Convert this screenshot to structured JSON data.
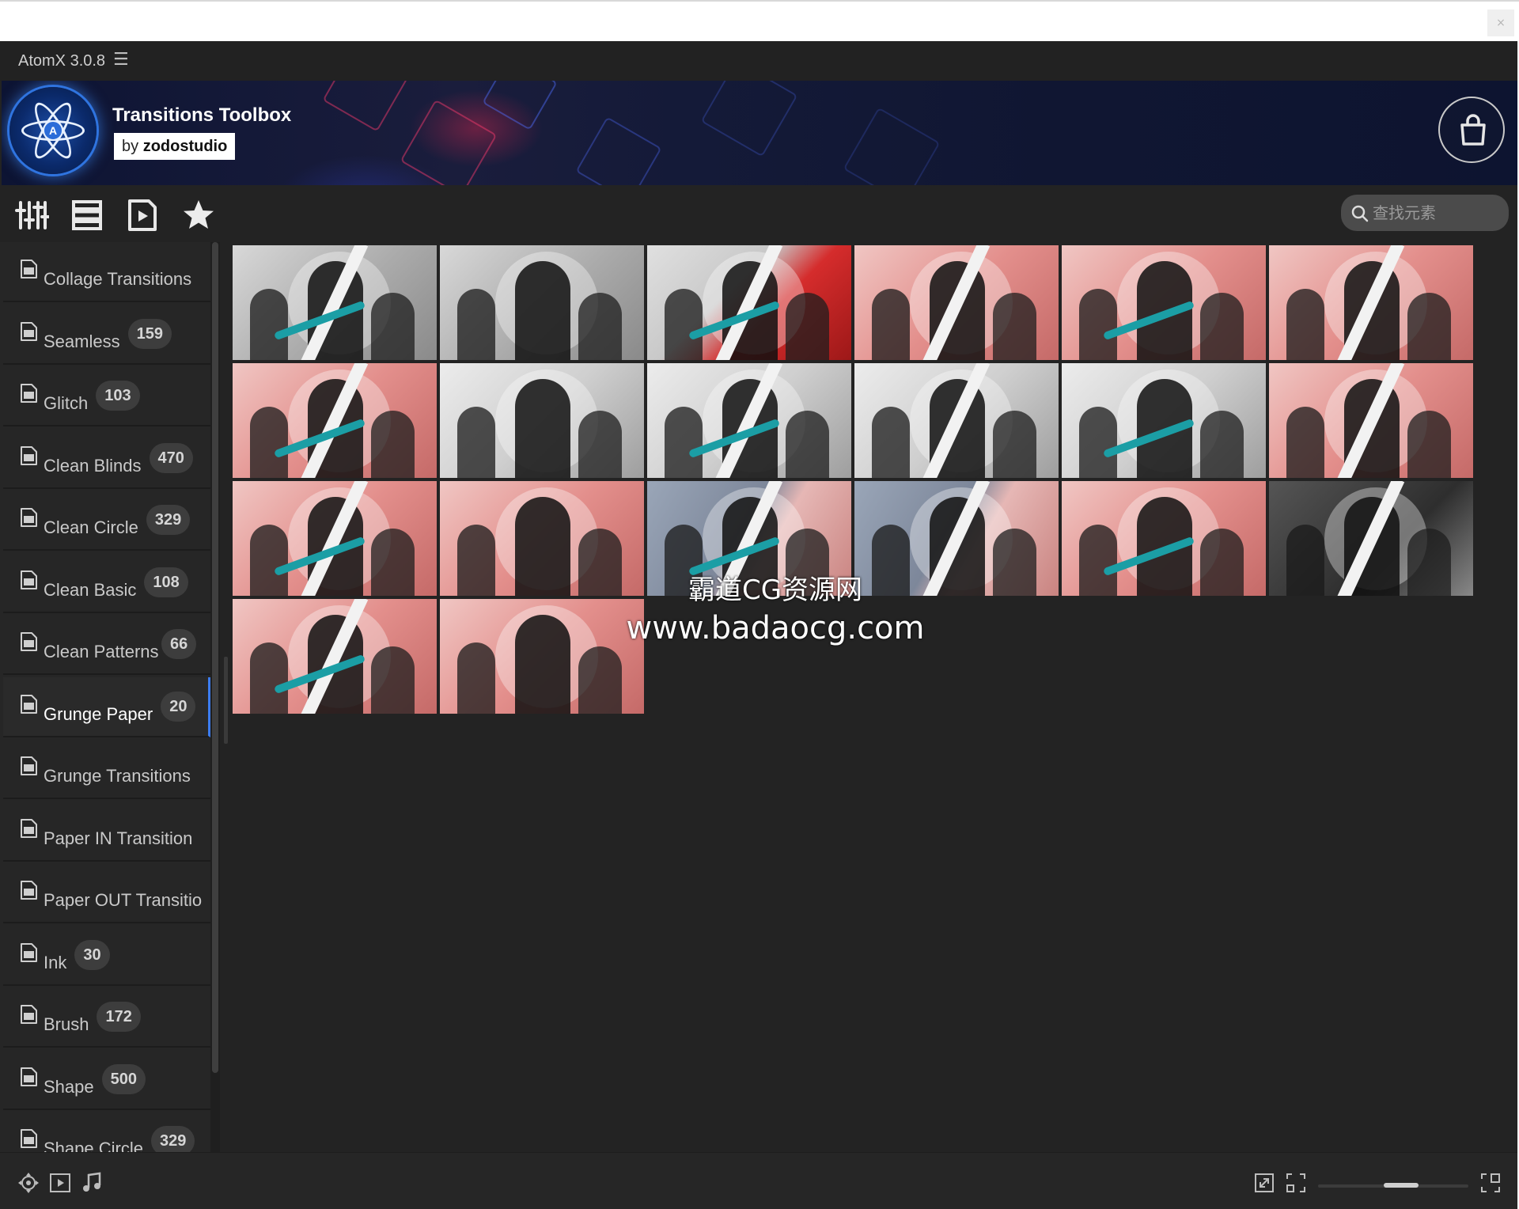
{
  "app": {
    "title": "AtomX 3.0.8",
    "menu_icon": "hamburger-icon",
    "close_glyph": "×"
  },
  "banner": {
    "title": "Transitions Toolbox",
    "by_prefix": "by",
    "author": "zodostudio",
    "logo_letter": "A"
  },
  "toolbar": {
    "icons": [
      "sliders-icon",
      "list-icon",
      "video-file-icon",
      "star-icon"
    ]
  },
  "search": {
    "placeholder": "查找元素",
    "value": ""
  },
  "sidebar": {
    "items": [
      {
        "label": "Collage Transitions",
        "count": null,
        "active": false
      },
      {
        "label": "Seamless",
        "count": "159",
        "active": false
      },
      {
        "label": "Glitch",
        "count": "103",
        "active": false
      },
      {
        "label": "Clean Blinds",
        "count": "470",
        "active": false
      },
      {
        "label": "Clean Circle",
        "count": "329",
        "active": false
      },
      {
        "label": "Clean Basic",
        "count": "108",
        "active": false
      },
      {
        "label": "Clean Patterns",
        "count": "66",
        "active": false
      },
      {
        "label": "Grunge Paper",
        "count": "20",
        "active": true
      },
      {
        "label": "Grunge Transitions",
        "count": null,
        "active": false
      },
      {
        "label": "Paper IN Transition",
        "count": null,
        "active": false
      },
      {
        "label": "Paper OUT Transitio",
        "count": null,
        "active": false
      },
      {
        "label": "Ink",
        "count": "30",
        "active": false
      },
      {
        "label": "Brush",
        "count": "172",
        "active": false
      },
      {
        "label": "Shape",
        "count": "500",
        "active": false
      },
      {
        "label": "Shape Circle",
        "count": "329",
        "active": false
      }
    ]
  },
  "grid": {
    "thumbnail_count": 20,
    "styles": [
      "gray",
      "gray",
      "red",
      "pink",
      "pink",
      "pink",
      "pink",
      "paper",
      "paper",
      "paper",
      "paper",
      "pink",
      "pink",
      "pink",
      "mix",
      "mix",
      "pink",
      "dark",
      "pink",
      "pink"
    ]
  },
  "watermark": {
    "line1": "霸道CG资源网",
    "line2": "www.badaocg.com"
  },
  "statusbar": {
    "left_icons": [
      "move-icon",
      "video-play-icon",
      "music-note-icon"
    ],
    "right_icons": [
      "expand-icon",
      "fit-icon",
      "fullscreen-icon"
    ],
    "zoom": 0.55
  },
  "colors": {
    "accent": "#3b7cf0",
    "teal_stroke": "#1b9ea5",
    "panel": "#262626"
  }
}
